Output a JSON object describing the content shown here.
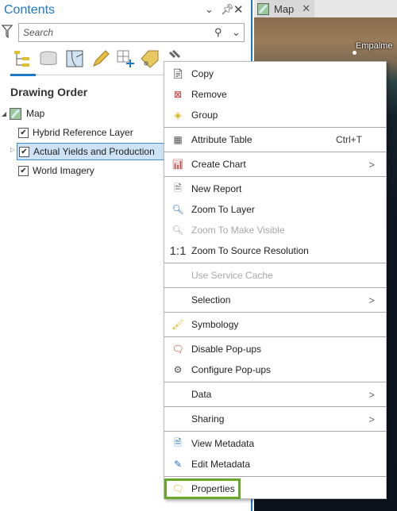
{
  "contents": {
    "title": "Contents",
    "search_placeholder": "Search",
    "section_title": "Drawing Order",
    "map_label": "Map",
    "layers": [
      {
        "label": "Hybrid Reference Layer",
        "checked": true
      },
      {
        "label": "Actual Yields and Production",
        "checked": true,
        "selected": true
      },
      {
        "label": "World Imagery",
        "checked": true
      }
    ]
  },
  "map_tab": {
    "label": "Map",
    "place_label": "Empalme"
  },
  "menu": {
    "copy": "Copy",
    "remove": "Remove",
    "group": "Group",
    "attribute_table": "Attribute Table",
    "attribute_table_shortcut": "Ctrl+T",
    "create_chart": "Create Chart",
    "new_report": "New Report",
    "zoom_to_layer": "Zoom To Layer",
    "zoom_to_make_visible": "Zoom To Make Visible",
    "zoom_source_icon": "1:1",
    "zoom_to_source_resolution": "Zoom To Source Resolution",
    "use_service_cache": "Use Service Cache",
    "selection": "Selection",
    "symbology": "Symbology",
    "disable_popups": "Disable Pop-ups",
    "configure_popups": "Configure Pop-ups",
    "data": "Data",
    "sharing": "Sharing",
    "view_metadata": "View Metadata",
    "edit_metadata": "Edit Metadata",
    "properties": "Properties"
  },
  "colors": {
    "accent": "#1e78c8",
    "highlight": "#6aa82a",
    "selection": "#cde3f5"
  }
}
